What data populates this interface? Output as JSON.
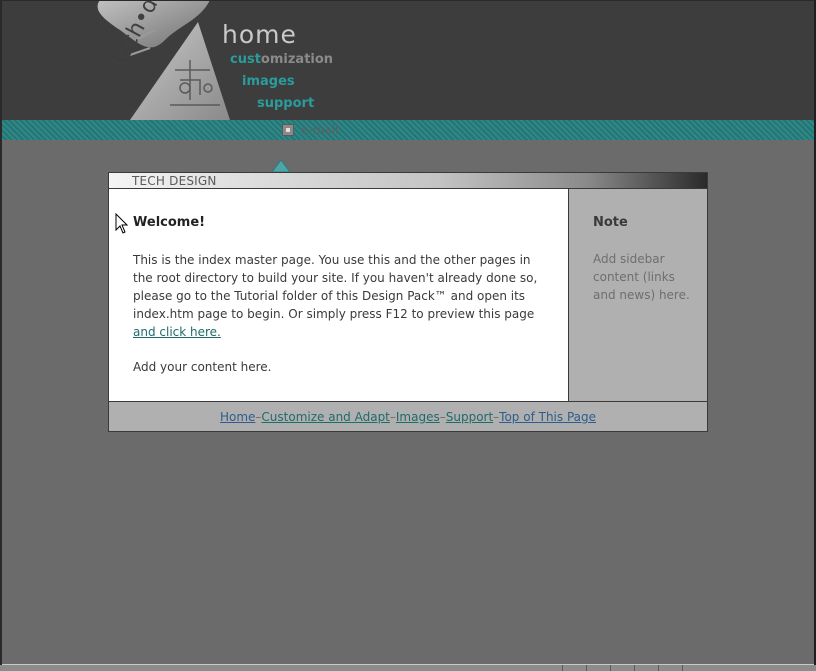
{
  "logo": {
    "text": "tech•design"
  },
  "nav": {
    "home": "home",
    "customization_prefix": "cust",
    "customization_rest": "omization",
    "images": "images",
    "support": "support",
    "email": "e-mail"
  },
  "box": {
    "header_label": "TECH DESIGN"
  },
  "main": {
    "title": "Welcome!",
    "body": "This is the index master page. You use this and the other pages in the root directory to build your site. If you haven't already done so, please go to the Tutorial folder of this Design Pack™ and open its index.htm page to begin. Or simply press F12 to preview this page",
    "link": "and click here.",
    "extra": "Add your content here."
  },
  "sidebar": {
    "title": "Note",
    "body": "Add sidebar content (links and news) here."
  },
  "footer": {
    "links": [
      "Home",
      "Customize and Adapt",
      "Images",
      "Support",
      "Top of This Page"
    ],
    "separator": "–"
  },
  "colors": {
    "header_bg": "#3d3d3d",
    "teal_bar": "#2f8787",
    "page_bg": "#6b6b6b",
    "nav_accent": "#2a9c9c",
    "link_blue": "#2d5d8c",
    "link_teal": "#1f6b6b"
  },
  "icons": [
    "email-icon",
    "triangle-marker-icon",
    "mouse-cursor-icon"
  ]
}
